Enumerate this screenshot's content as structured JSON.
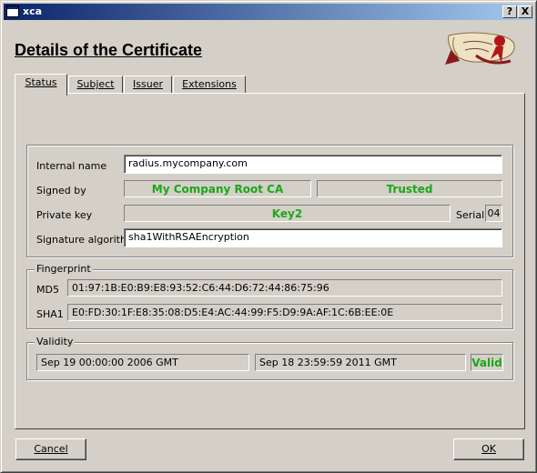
{
  "window": {
    "title": "xca",
    "help_button": "?",
    "close_button": "X"
  },
  "heading": "Details of the Certificate",
  "tabs": [
    {
      "label": "Status",
      "active": true
    },
    {
      "label": "Subject",
      "active": false
    },
    {
      "label": "Issuer",
      "active": false
    },
    {
      "label": "Extensions",
      "active": false
    }
  ],
  "details": {
    "internal_name_label": "Internal name",
    "internal_name_value": "radius.mycompany.com",
    "signed_by_label": "Signed by",
    "signed_by_value": "My Company Root CA",
    "trust_value": "Trusted",
    "private_key_label": "Private key",
    "private_key_value": "Key2",
    "serial_label": "Serial",
    "serial_value": "04",
    "signature_algorithm_label": "Signature algorithm",
    "signature_algorithm_value": "sha1WithRSAEncryption"
  },
  "fingerprint": {
    "group_title": "Fingerprint",
    "md5_label": "MD5",
    "md5_value": "01:97:1B:E0:B9:E8:93:52:C6:44:D6:72:44:86:75:96",
    "sha1_label": "SHA1",
    "sha1_value": "E0:FD:30:1F:E8:35:08:D5:E4:AC:44:99:F5:D9:9A:AF:1C:6B:EE:0E"
  },
  "validity": {
    "group_title": "Validity",
    "not_before": "Sep 19 00:00:00 2006 GMT",
    "not_after": "Sep 18 23:59:59 2011 GMT",
    "status": "Valid"
  },
  "buttons": {
    "cancel": "Cancel",
    "ok": "OK"
  },
  "colors": {
    "status_green": "#1aa71a",
    "titlebar": "#0a246a"
  }
}
